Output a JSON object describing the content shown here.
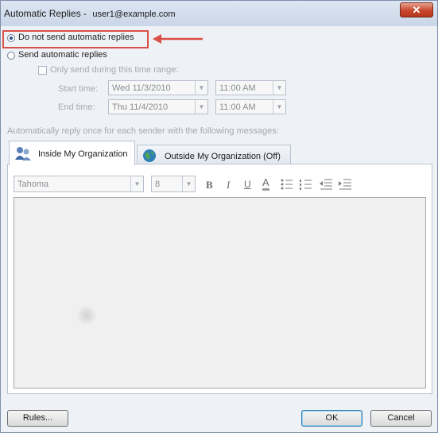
{
  "window": {
    "title": "Automatic Replies -",
    "account": "user1@example.com",
    "close_glyph": "✕"
  },
  "options": {
    "no_replies_label": "Do not send automatic replies",
    "send_replies_label": "Send automatic replies",
    "time_range_label": "Only send during this time range:",
    "start_time_label": "Start time:",
    "end_time_label": "End time:",
    "start_date": "Wed 11/3/2010",
    "start_time": "11:00 AM",
    "end_date": "Thu 11/4/2010",
    "end_time": "11:00 AM",
    "reply_once_text": "Automatically reply once for each sender with the following messages:"
  },
  "tabs": {
    "inside_label": "Inside My Organization",
    "outside_label": "Outside My Organization (Off)"
  },
  "format": {
    "font_name": "Tahoma",
    "font_size": "8",
    "bold": "B",
    "italic": "I",
    "underline": "U",
    "font_color": "A"
  },
  "buttons": {
    "rules": "Rules...",
    "ok": "OK",
    "cancel": "Cancel"
  },
  "colors": {
    "highlight": "#d94f45",
    "close_button": "#c8462b"
  }
}
